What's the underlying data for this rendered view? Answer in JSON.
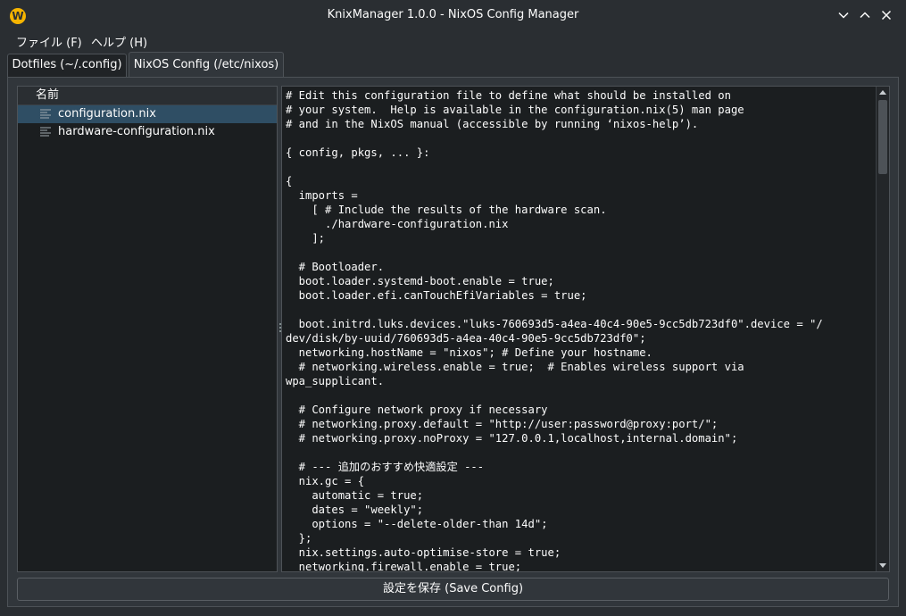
{
  "window": {
    "title": "KnixManager 1.0.0 - NixOS Config Manager",
    "app_icon_letter": "W"
  },
  "menu": {
    "file": "ファイル (F)",
    "help": "ヘルプ (H)"
  },
  "tabs": [
    {
      "label": "Dotfiles (~/.config)",
      "active": false
    },
    {
      "label": "NixOS Config (/etc/nixos)",
      "active": true
    }
  ],
  "tree": {
    "header": "名前",
    "items": [
      {
        "label": "configuration.nix",
        "selected": true,
        "icon": "text-file-icon"
      },
      {
        "label": "hardware-configuration.nix",
        "selected": false,
        "icon": "text-file-icon"
      }
    ]
  },
  "editor": {
    "lines": [
      "# Edit this configuration file to define what should be installed on",
      "# your system.  Help is available in the configuration.nix(5) man page",
      "# and in the NixOS manual (accessible by running ‘nixos-help’).",
      "",
      "{ config, pkgs, ... }:",
      "",
      "{",
      "  imports =",
      "    [ # Include the results of the hardware scan.",
      "      ./hardware-configuration.nix",
      "    ];",
      "",
      "  # Bootloader.",
      "  boot.loader.systemd-boot.enable = true;",
      "  boot.loader.efi.canTouchEfiVariables = true;",
      "",
      "  boot.initrd.luks.devices.\"luks-760693d5-a4ea-40c4-90e5-9cc5db723df0\".device = \"/",
      "dev/disk/by-uuid/760693d5-a4ea-40c4-90e5-9cc5db723df0\";",
      "  networking.hostName = \"nixos\"; # Define your hostname.",
      "  # networking.wireless.enable = true;  # Enables wireless support via",
      "wpa_supplicant.",
      "",
      "  # Configure network proxy if necessary",
      "  # networking.proxy.default = \"http://user:password@proxy:port/\";",
      "  # networking.proxy.noProxy = \"127.0.0.1,localhost,internal.domain\";",
      "",
      "  # --- 追加のおすすめ快適設定 ---",
      "  nix.gc = {",
      "    automatic = true;",
      "    dates = \"weekly\";",
      "    options = \"--delete-older-than 14d\";",
      "  };",
      "  nix.settings.auto-optimise-store = true;",
      "  networking.firewall.enable = true;"
    ]
  },
  "save_button": "設定を保存 (Save Config)"
}
